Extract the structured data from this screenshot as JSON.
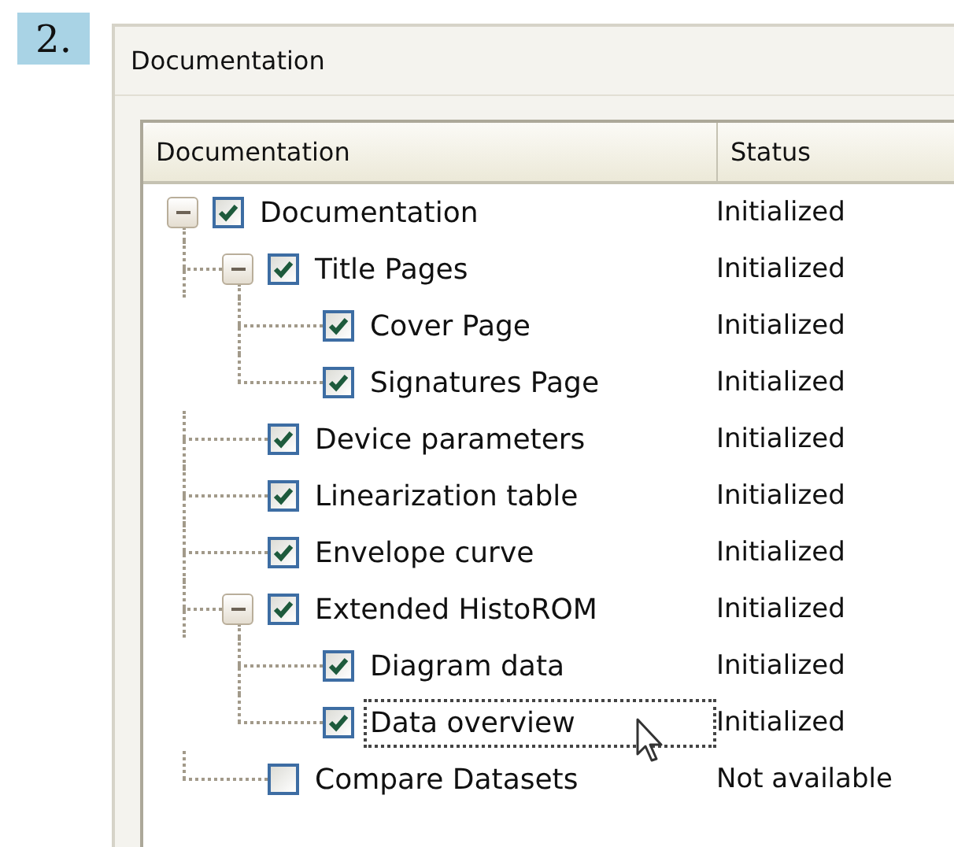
{
  "step": "2.",
  "group": {
    "title": "Documentation"
  },
  "columns": [
    "Documentation",
    "Status"
  ],
  "tree": [
    {
      "label": "Documentation",
      "status": "Initialized",
      "checked": true,
      "expanded": true,
      "focused": false,
      "children": [
        {
          "label": "Title Pages",
          "status": "Initialized",
          "checked": true,
          "expanded": true,
          "focused": false,
          "children": [
            {
              "label": "Cover Page",
              "status": "Initialized",
              "checked": true,
              "focused": false
            },
            {
              "label": "Signatures Page",
              "status": "Initialized",
              "checked": true,
              "focused": false
            }
          ]
        },
        {
          "label": "Device parameters",
          "status": "Initialized",
          "checked": true,
          "focused": false
        },
        {
          "label": "Linearization table",
          "status": "Initialized",
          "checked": true,
          "focused": false
        },
        {
          "label": "Envelope curve",
          "status": "Initialized",
          "checked": true,
          "focused": false
        },
        {
          "label": "Extended HistoROM",
          "status": "Initialized",
          "checked": true,
          "expanded": true,
          "focused": false,
          "children": [
            {
              "label": "Diagram data",
              "status": "Initialized",
              "checked": true,
              "focused": false
            },
            {
              "label": "Data overview",
              "status": "Initialized",
              "checked": true,
              "focused": true,
              "hovered": true
            }
          ]
        },
        {
          "label": "Compare Datasets",
          "status": "Not available",
          "checked": false,
          "focused": false
        }
      ]
    }
  ]
}
